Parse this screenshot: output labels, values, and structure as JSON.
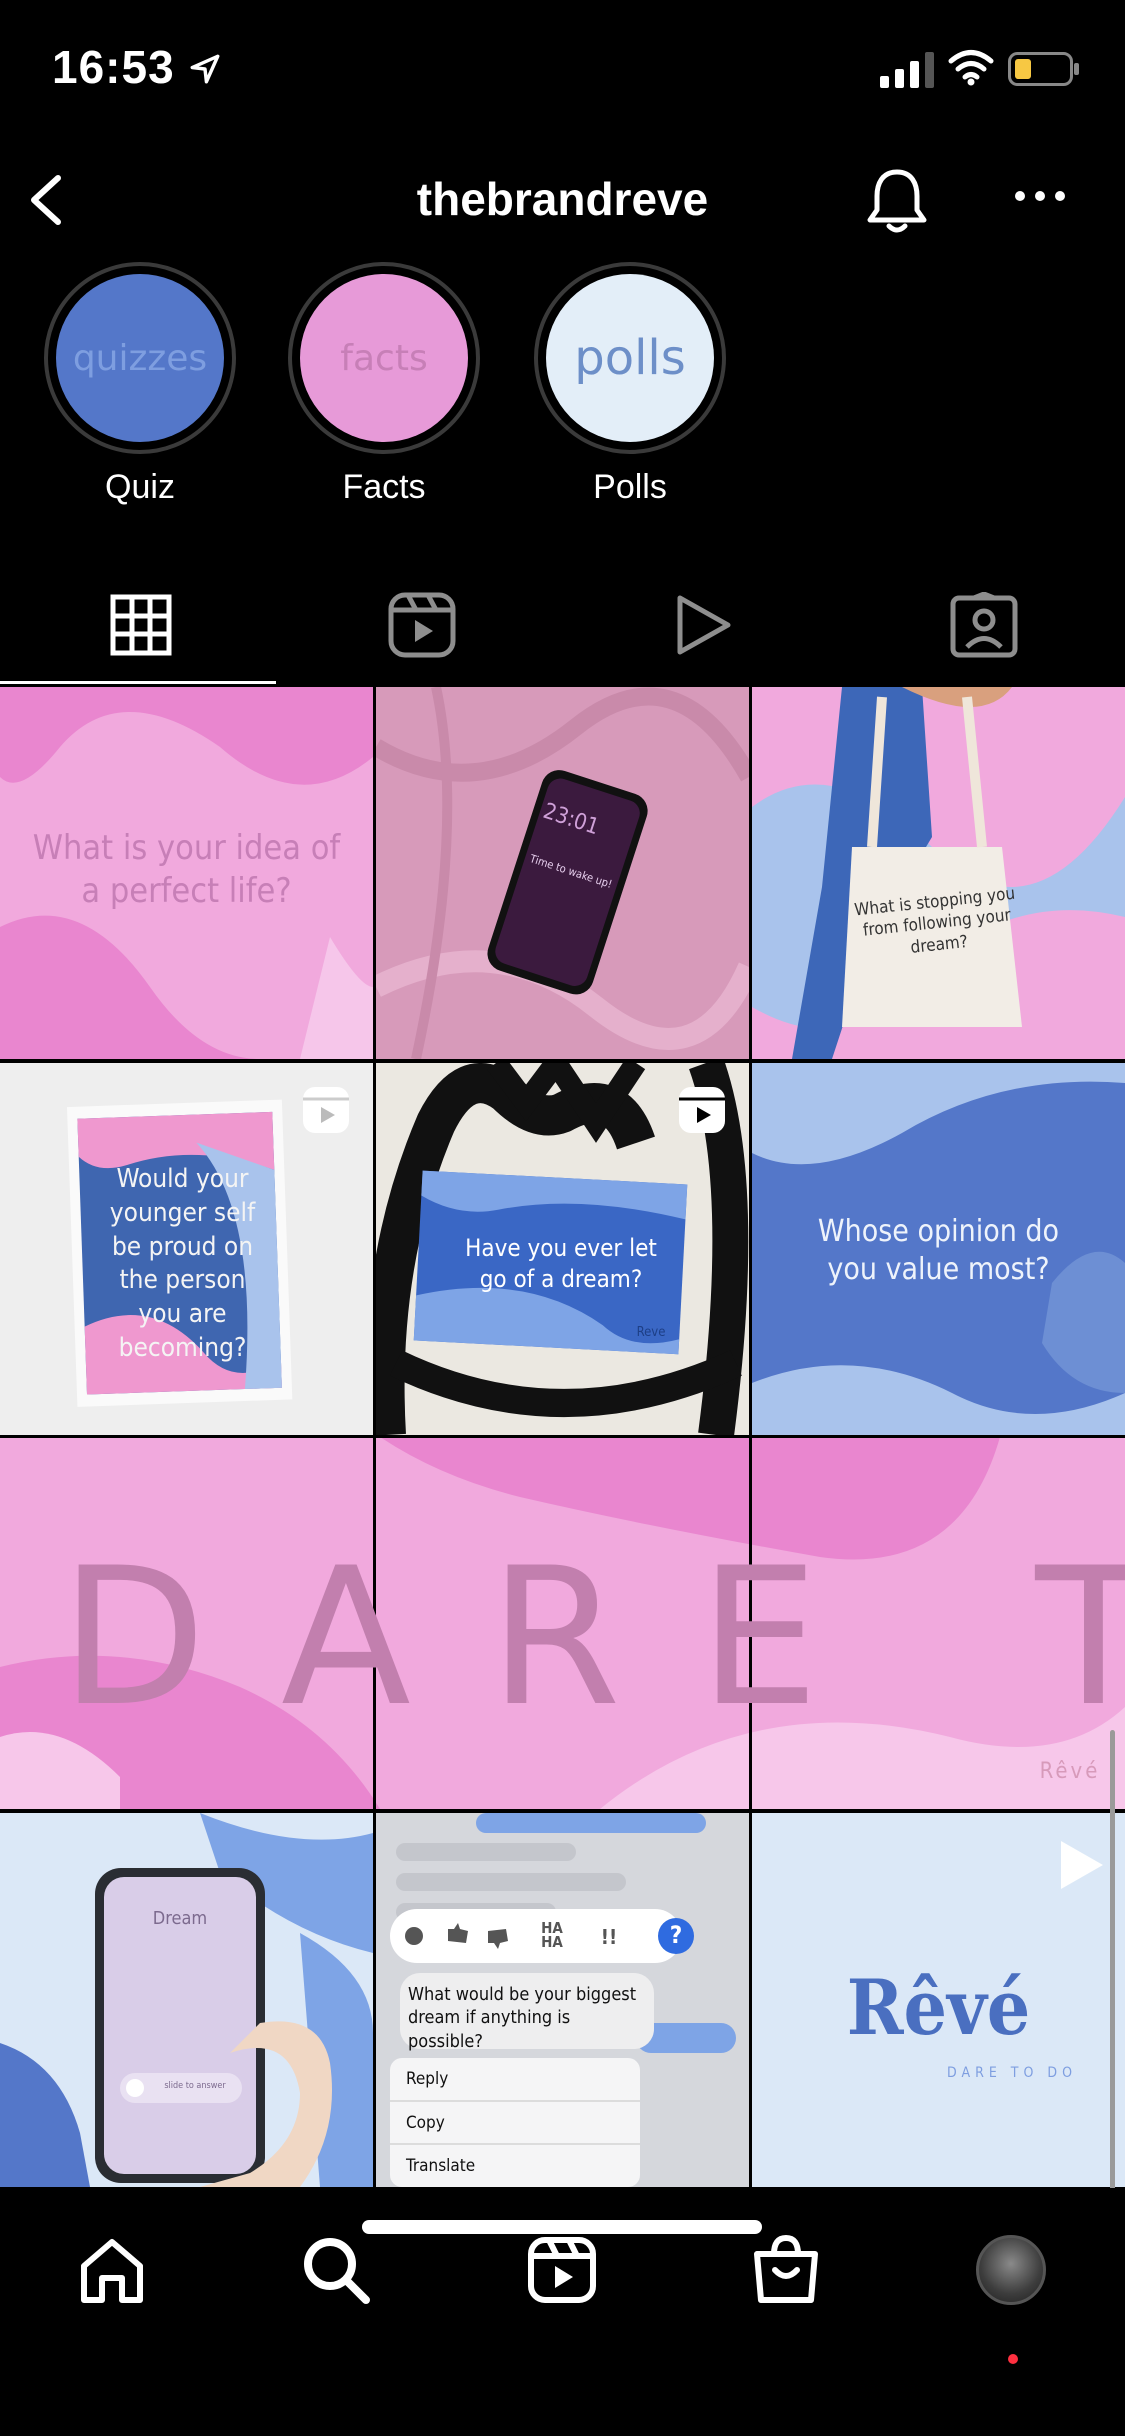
{
  "status_bar": {
    "time": "16:53"
  },
  "header": {
    "username": "thebrandreve"
  },
  "highlights": [
    {
      "cover_text": "quizzes",
      "label": "Quiz",
      "bg": "#5477c9",
      "fg": "#7e9ee0"
    },
    {
      "cover_text": "facts",
      "label": "Facts",
      "bg": "#e79ad8",
      "fg": "#c77fb7"
    },
    {
      "cover_text": "polls",
      "label": "Polls",
      "bg": "#e3eef8",
      "fg": "#6d8fc8"
    }
  ],
  "tabs": [
    "posts-grid",
    "reels",
    "videos",
    "tagged"
  ],
  "posts": {
    "p1": {
      "text": "What is your idea of a perfect life?"
    },
    "p2": {
      "phone_time": "23:01",
      "phone_alarm": "Time to wake up!"
    },
    "p3": {
      "text": "What is stopping you from following your dream?"
    },
    "p4": {
      "text": "Would your younger self be proud on the person you are becoming?"
    },
    "p5": {
      "text": "Have you ever let go of a dream?",
      "brand": "Reve"
    },
    "p6": {
      "text": "Whose opinion do you value most?"
    },
    "dare": {
      "text": "DARE TO DO",
      "brand": "Rêvé"
    },
    "p10": {
      "caller": "Dream",
      "slide": "slide to answer"
    },
    "p11": {
      "message": "What would be your biggest dream if anything is possible?",
      "reactions": [
        "heart",
        "thumbs-up",
        "thumbs-down",
        "HA HA",
        "!!",
        "?"
      ],
      "menu": [
        "Reply",
        "Copy",
        "Translate"
      ]
    },
    "p12": {
      "brand": "Rêvé",
      "tagline": "DARE TO DO"
    }
  },
  "colors": {
    "pink": "#f1a9dd",
    "pink_dark": "#e986cf",
    "blue": "#5477c9",
    "light_blue": "#dbe8f7"
  }
}
